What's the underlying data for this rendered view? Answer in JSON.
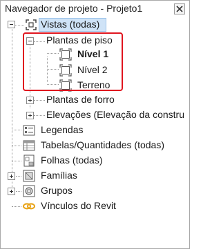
{
  "panel": {
    "title": "Navegador de projeto - Projeto1",
    "close_icon": "close-icon"
  },
  "tree": {
    "root": {
      "label": "Vistas (todas)",
      "icon": "views-icon",
      "expanded": true,
      "selected": true
    },
    "plantas_piso": {
      "label": "Plantas de piso",
      "expanded": true
    },
    "level_items": [
      {
        "label": "Nível 1",
        "icon": "floor-plan-view-icon",
        "bold": true
      },
      {
        "label": "Nível 2",
        "icon": "floor-plan-view-icon",
        "bold": false
      },
      {
        "label": "Terreno",
        "icon": "floor-plan-view-icon",
        "bold": false
      }
    ],
    "plantas_forro": {
      "label": "Plantas de forro",
      "expanded": false
    },
    "elevacoes": {
      "label": "Elevações (Elevação da constru",
      "expanded": false
    },
    "legendas": {
      "label": "Legendas",
      "icon": "legend-icon"
    },
    "tabelas": {
      "label": "Tabelas/Quantidades (todas)",
      "icon": "schedule-icon"
    },
    "folhas": {
      "label": "Folhas (todas)",
      "icon": "sheet-icon"
    },
    "familias": {
      "label": "Famílias",
      "icon": "family-icon",
      "expanded": false
    },
    "grupos": {
      "label": "Grupos",
      "icon": "group-icon",
      "expanded": false
    },
    "vinculos": {
      "label": "Vínculos do Revit",
      "icon": "link-icon"
    }
  },
  "colors": {
    "selection": "#cfe3f7",
    "highlight_border": "#e0141e",
    "link_icon": "#e8a317"
  }
}
